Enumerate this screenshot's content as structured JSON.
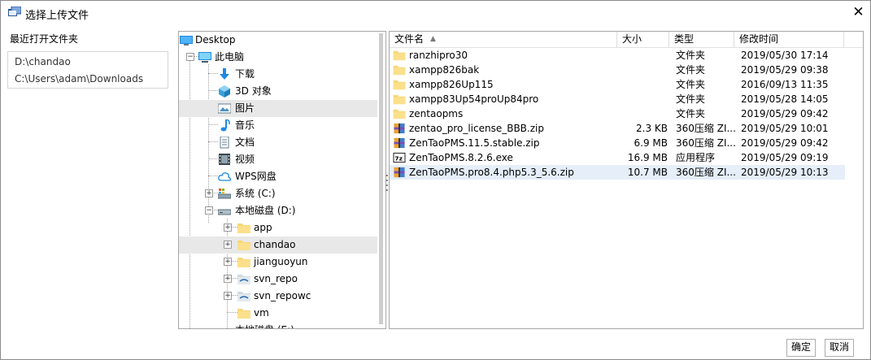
{
  "window": {
    "title": "选择上传文件",
    "close_glyph": "✕"
  },
  "recent": {
    "title": "最近打开文件夹",
    "items": [
      "D:\\chandao",
      "C:\\Users\\adam\\Downloads"
    ]
  },
  "tree": {
    "items": [
      {
        "label": "Desktop",
        "icon": "desktop-icon"
      },
      {
        "label": "此电脑",
        "icon": "computer-icon"
      },
      {
        "label": "下载",
        "icon": "download-icon"
      },
      {
        "label": "3D 对象",
        "icon": "3d-objects-icon"
      },
      {
        "label": "图片",
        "icon": "pictures-icon"
      },
      {
        "label": "音乐",
        "icon": "music-icon"
      },
      {
        "label": "文档",
        "icon": "documents-icon"
      },
      {
        "label": "视频",
        "icon": "videos-icon"
      },
      {
        "label": "WPS网盘",
        "icon": "cloud-icon"
      },
      {
        "label": "系统 (C:)",
        "icon": "system-drive-icon"
      },
      {
        "label": "本地磁盘 (D:)",
        "icon": "drive-icon"
      },
      {
        "label": "app",
        "icon": "folder-icon"
      },
      {
        "label": "chandao",
        "icon": "folder-icon"
      },
      {
        "label": "jianguoyun",
        "icon": "folder-icon"
      },
      {
        "label": "svn_repo",
        "icon": "svn-folder-icon"
      },
      {
        "label": "svn_repowc",
        "icon": "svn-folder-icon"
      },
      {
        "label": "vm",
        "icon": "folder-icon"
      },
      {
        "label": "本地磁盘 (E:)",
        "icon": "drive-icon"
      }
    ]
  },
  "list": {
    "columns": {
      "name": "文件名",
      "size": "大小",
      "type": "类型",
      "modified": "修改时间"
    },
    "sort_glyph": "▲",
    "rows": [
      {
        "name": "ranzhipro30",
        "size": "",
        "type": "文件夹",
        "modified": "2019/05/30 17:14",
        "icon": "folder-icon"
      },
      {
        "name": "xampp826bak",
        "size": "",
        "type": "文件夹",
        "modified": "2019/05/29 09:38",
        "icon": "folder-icon"
      },
      {
        "name": "xampp826Up115",
        "size": "",
        "type": "文件夹",
        "modified": "2016/09/13 11:35",
        "icon": "folder-icon"
      },
      {
        "name": "xampp83Up54proUp84pro",
        "size": "",
        "type": "文件夹",
        "modified": "2019/05/28 14:05",
        "icon": "folder-icon"
      },
      {
        "name": "zentaopms",
        "size": "",
        "type": "文件夹",
        "modified": "2019/05/29 09:42",
        "icon": "folder-icon"
      },
      {
        "name": "zentao_pro_license_BBB.zip",
        "size": "2.3 KB",
        "type": "360压缩 ZI...",
        "modified": "2019/05/29 10:01",
        "icon": "zip-archive-icon"
      },
      {
        "name": "ZenTaoPMS.11.5.stable.zip",
        "size": "6.9 MB",
        "type": "360压缩 ZI...",
        "modified": "2019/05/29 09:42",
        "icon": "zip-archive-icon"
      },
      {
        "name": "ZenTaoPMS.8.2.6.exe",
        "size": "16.9 MB",
        "type": "应用程序",
        "modified": "2019/05/29 09:19",
        "icon": "exe-7z-icon"
      },
      {
        "name": "ZenTaoPMS.pro8.4.php5.3_5.6.zip",
        "size": "10.7 MB",
        "type": "360压缩 ZI...",
        "modified": "2019/05/29 10:13",
        "icon": "zip-archive-icon"
      }
    ]
  },
  "buttons": {
    "ok": "确定",
    "cancel": "取消"
  },
  "colors": {
    "folder": "#f8d775",
    "selection": "#e5eef9",
    "accent": "#1e88e5"
  }
}
